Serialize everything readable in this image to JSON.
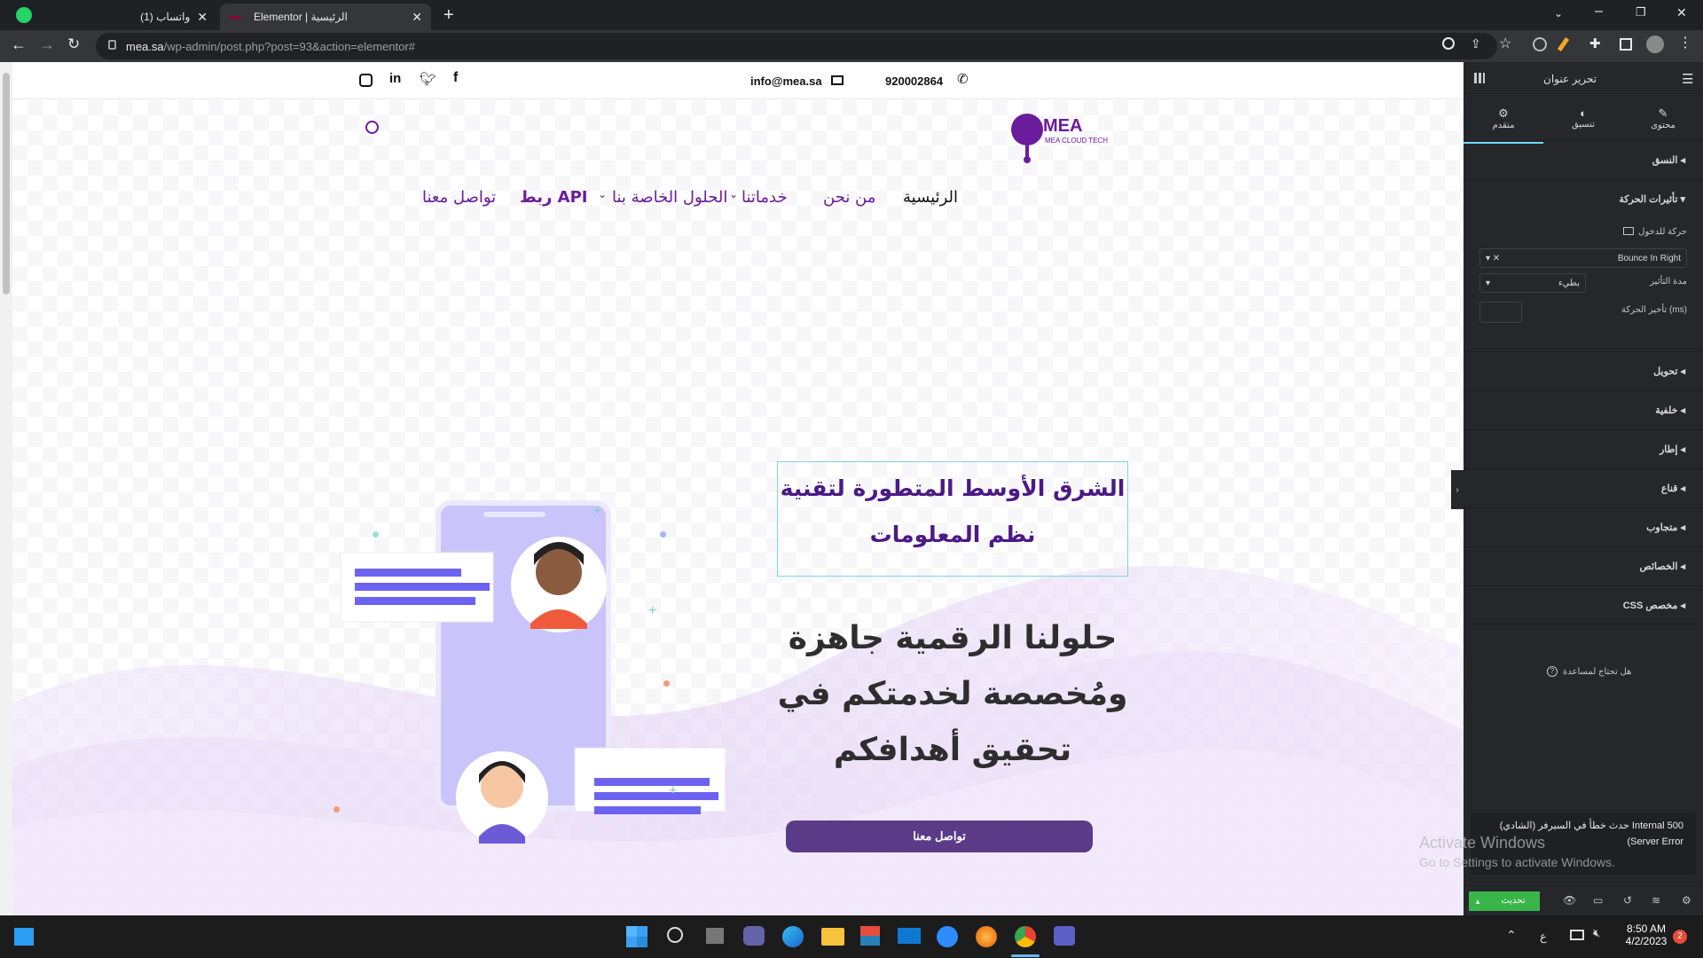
{
  "browser": {
    "tabs": [
      {
        "label": "(1) واتساب"
      },
      {
        "label": "Elementor | الرئيسية"
      }
    ],
    "url_host": "mea.sa",
    "url_path": "/wp-admin/post.php?post=93&action=elementor#"
  },
  "site": {
    "phone": "920002864",
    "email": "info@mea.sa",
    "logo_text": "MEA CLOUD TECH",
    "nav": [
      "الرئيسية",
      "من نحن",
      "خدماتنا",
      "الحلول الخاصة بنا",
      "ربط API",
      "تواصل معنا"
    ],
    "headline": "الشرق الأوسط المتطورة لتقنية نظم المعلومات",
    "hero_lines": [
      "حلولنا الرقمية جاهزة",
      "ومُخصصة لخدمتكم في",
      "تحقيق أهدافكم"
    ],
    "cta_label": "تواصل معنا"
  },
  "panel": {
    "title": "تحرير عنوان",
    "tabs": [
      "محتوى",
      "تنسيق",
      "متقدم"
    ],
    "sections": {
      "layout": "النسق",
      "motion": "تأثيرات الحركة",
      "transform": "تحويل",
      "background": "خلفية",
      "border": "إطار",
      "mask": "قناع",
      "responsive": "متجاوب",
      "attributes": "الخصائص",
      "custom_css": "CSS مخصص"
    },
    "entrance_label": "حركة للدخول",
    "entrance_value": "Bounce In Right",
    "duration_label": "مدة التأثير",
    "duration_value": "بطيء",
    "delay_label": "تأخير الحركة (ms)",
    "help": "هل تحتاج لمساعدة",
    "update_btn": "تحديث"
  },
  "notification": {
    "line1": "حدث خطأ في السيرفر (الشادي) Internal 500",
    "line2": "(Server Error"
  },
  "watermark": {
    "line1": "Activate Windows",
    "line2": "Go to Settings to activate Windows."
  },
  "taskbar": {
    "lang": "ع",
    "time": "8:50 AM",
    "date": "4/2/2023",
    "badge": "2"
  }
}
